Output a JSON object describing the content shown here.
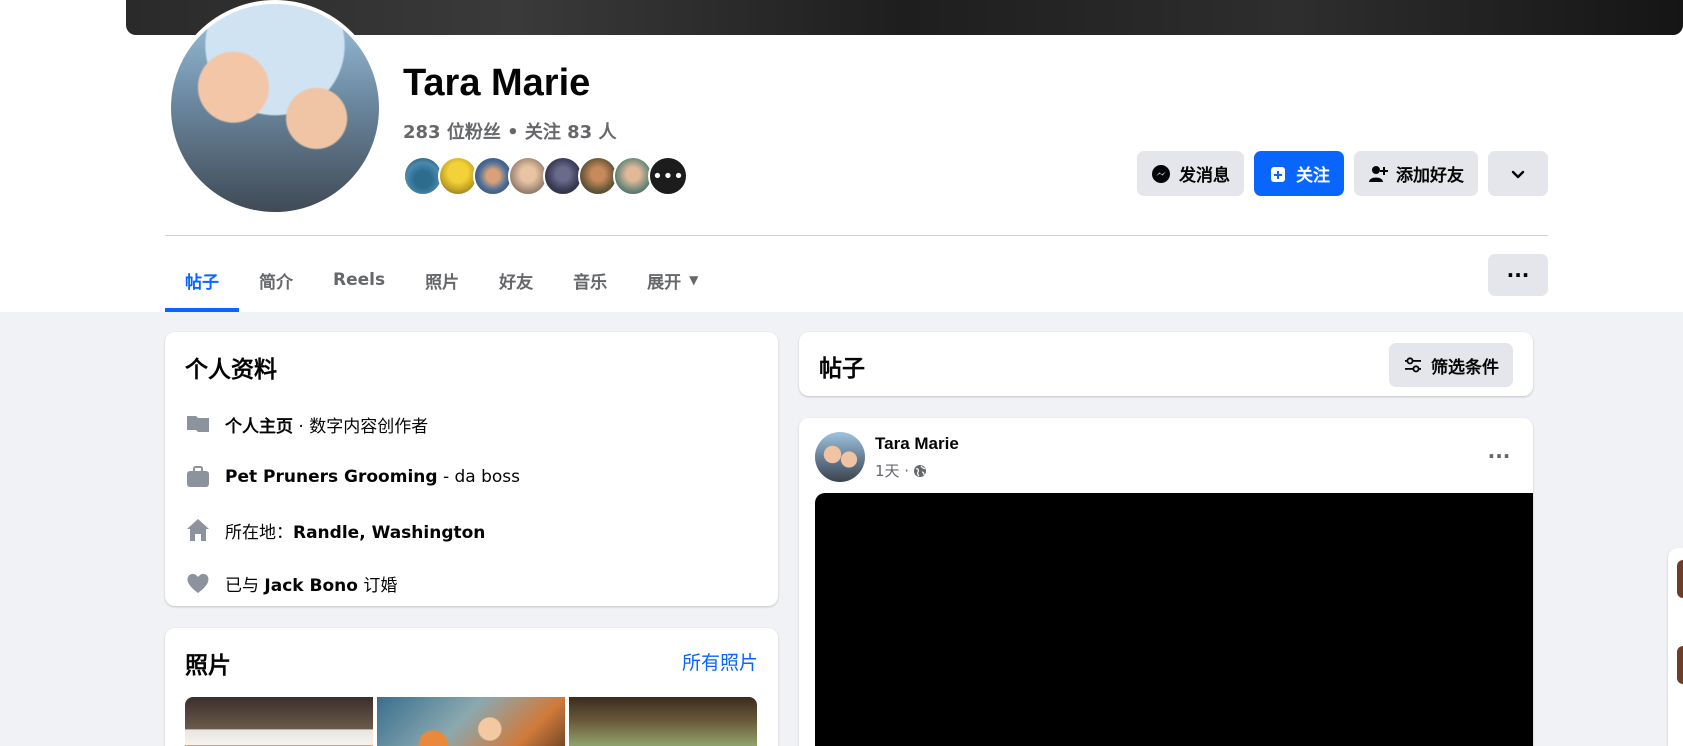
{
  "profile": {
    "name": "Tara Marie",
    "stats": "283 位粉丝 • 关注 83 人",
    "friend_more": "•••"
  },
  "actions": {
    "message": "发消息",
    "follow": "关注",
    "add_friend": "添加好友"
  },
  "tabs": [
    {
      "label": "帖子",
      "active": true
    },
    {
      "label": "简介"
    },
    {
      "label": "Reels"
    },
    {
      "label": "照片"
    },
    {
      "label": "好友"
    },
    {
      "label": "音乐"
    },
    {
      "label": "展开"
    }
  ],
  "more_label": "···",
  "intro": {
    "title": "个人资料",
    "page_bold": "个人主页",
    "page_rest": " · 数字内容创作者",
    "work_bold": "Pet Pruners Grooming",
    "work_rest": " - da boss",
    "location_prefix": "所在地：",
    "location_bold": "Randle, Washington",
    "relationship_prefix": "已与 ",
    "relationship_bold": "Jack Bono",
    "relationship_suffix": " 订婚"
  },
  "photos": {
    "title": "照片",
    "all_link": "所有照片"
  },
  "posts": {
    "title": "帖子",
    "filter": "筛选条件"
  },
  "post": {
    "author": "Tara Marie",
    "time": "1天 ·",
    "menu": "···"
  },
  "colors": {
    "accent": "#0866ff",
    "secondary_text": "#65676b",
    "button_gray": "#e4e6eb",
    "page_bg": "#f0f2f5"
  }
}
